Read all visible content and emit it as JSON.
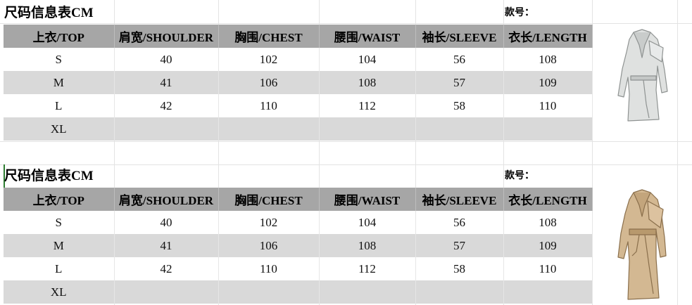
{
  "tables": [
    {
      "title": "尺码信息表CM",
      "style_label": "款号：",
      "headers": [
        "上衣/TOP",
        "肩宽/SHOULDER",
        "胸围/CHEST",
        "腰围/WAIST",
        "袖长/SLEEVE",
        "衣长/LENGTH"
      ],
      "rows": [
        [
          "S",
          "40",
          "102",
          "104",
          "56",
          "108"
        ],
        [
          "M",
          "41",
          "106",
          "108",
          "57",
          "109"
        ],
        [
          "L",
          "42",
          "110",
          "112",
          "58",
          "110"
        ],
        [
          "XL",
          "",
          "",
          "",
          "",
          ""
        ]
      ],
      "image": {
        "icon": "grey-trench-coat-photo",
        "color": "#dcdedd"
      }
    },
    {
      "title": "尺码信息表CM",
      "style_label": "款号：",
      "headers": [
        "上衣/TOP",
        "肩宽/SHOULDER",
        "胸围/CHEST",
        "腰围/WAIST",
        "袖长/SLEEVE",
        "衣长/LENGTH"
      ],
      "rows": [
        [
          "S",
          "40",
          "102",
          "104",
          "56",
          "108"
        ],
        [
          "M",
          "41",
          "106",
          "108",
          "57",
          "109"
        ],
        [
          "L",
          "42",
          "110",
          "112",
          "58",
          "110"
        ],
        [
          "XL",
          "",
          "",
          "",
          "",
          ""
        ]
      ],
      "image": {
        "icon": "beige-trench-coat-photo",
        "color": "#cfb48e"
      }
    }
  ]
}
